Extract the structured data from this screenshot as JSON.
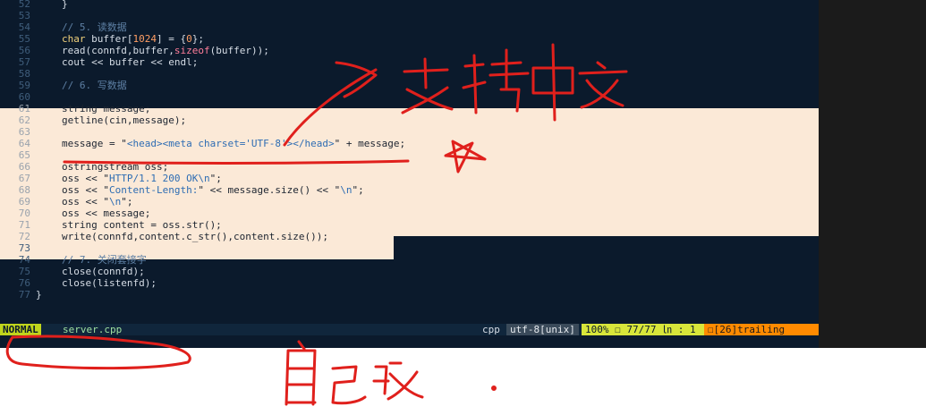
{
  "editor": {
    "lines": [
      {
        "num": "52",
        "parts": [
          {
            "t": "}",
            "c": ""
          }
        ],
        "indent": true
      },
      {
        "num": "53",
        "parts": []
      },
      {
        "num": "54",
        "parts": [
          {
            "t": "// 5. 读数据",
            "c": "comment"
          }
        ],
        "indent": true
      },
      {
        "num": "55",
        "parts": [
          {
            "t": "char",
            "c": "type"
          },
          {
            "t": " buffer[",
            "c": ""
          },
          {
            "t": "1024",
            "c": "num"
          },
          {
            "t": "] = {",
            "c": ""
          },
          {
            "t": "0",
            "c": "num"
          },
          {
            "t": "};",
            "c": ""
          }
        ],
        "indent": true
      },
      {
        "num": "56",
        "parts": [
          {
            "t": "read(connfd,buffer,",
            "c": ""
          },
          {
            "t": "sizeof",
            "c": "kw"
          },
          {
            "t": "(buffer));",
            "c": ""
          }
        ],
        "indent": true
      },
      {
        "num": "57",
        "parts": [
          {
            "t": "cout << buffer << endl;",
            "c": ""
          }
        ],
        "indent": true
      },
      {
        "num": "58",
        "parts": []
      },
      {
        "num": "59",
        "parts": [
          {
            "t": "// 6. 写数据",
            "c": "comment"
          }
        ],
        "indent": true
      },
      {
        "num": "60",
        "parts": []
      },
      {
        "num": "61",
        "parts": [
          {
            "t": "string message;",
            "c": ""
          }
        ],
        "indent": true,
        "sel": true
      },
      {
        "num": "62",
        "parts": [
          {
            "t": "getline(cin,message);",
            "c": ""
          }
        ],
        "indent": true,
        "sel": true
      },
      {
        "num": "63",
        "parts": [],
        "sel": true
      },
      {
        "num": "64",
        "parts": [
          {
            "t": "message = \"",
            "c": ""
          },
          {
            "t": "<head><meta charset='UTF-8'></head>",
            "c": "str"
          },
          {
            "t": "\" + message;",
            "c": ""
          }
        ],
        "indent": true,
        "sel": true
      },
      {
        "num": "65",
        "parts": [],
        "sel": true
      },
      {
        "num": "66",
        "parts": [
          {
            "t": "ostringstream oss;",
            "c": ""
          }
        ],
        "indent": true,
        "sel": true
      },
      {
        "num": "67",
        "parts": [
          {
            "t": "oss << \"",
            "c": ""
          },
          {
            "t": "HTTP/1.1 200 OK\\n",
            "c": "str"
          },
          {
            "t": "\";",
            "c": ""
          }
        ],
        "indent": true,
        "sel": true
      },
      {
        "num": "68",
        "parts": [
          {
            "t": "oss << \"",
            "c": ""
          },
          {
            "t": "Content-Length:",
            "c": "str"
          },
          {
            "t": "\" << message.size() << \"",
            "c": ""
          },
          {
            "t": "\\n",
            "c": "str"
          },
          {
            "t": "\";",
            "c": ""
          }
        ],
        "indent": true,
        "sel": true
      },
      {
        "num": "69",
        "parts": [
          {
            "t": "oss << \"",
            "c": ""
          },
          {
            "t": "\\n",
            "c": "str"
          },
          {
            "t": "\";",
            "c": ""
          }
        ],
        "indent": true,
        "sel": true
      },
      {
        "num": "70",
        "parts": [
          {
            "t": "oss << message;",
            "c": ""
          }
        ],
        "indent": true,
        "sel": true
      },
      {
        "num": "71",
        "parts": [
          {
            "t": "string content = oss.str();",
            "c": ""
          }
        ],
        "indent": true,
        "sel": true
      },
      {
        "num": "72",
        "parts": [
          {
            "t": "write(connfd,content.c_str(),content.size());",
            "c": ""
          }
        ],
        "indent": true,
        "sel": true
      },
      {
        "num": "73",
        "parts": []
      },
      {
        "num": "74",
        "parts": [
          {
            "t": "// 7. 关闭套接字",
            "c": "comment"
          }
        ],
        "indent": true
      },
      {
        "num": "75",
        "parts": [
          {
            "t": "close(connfd);",
            "c": ""
          }
        ],
        "indent": true
      },
      {
        "num": "76",
        "parts": [
          {
            "t": "close(listenfd);",
            "c": ""
          }
        ],
        "indent": true
      },
      {
        "num": "77",
        "parts": [
          {
            "t": "}",
            "c": ""
          }
        ]
      }
    ]
  },
  "statusline": {
    "mode": "NORMAL",
    "filename": "server.cpp",
    "filetype": "cpp",
    "encoding": "utf-8[unix]",
    "position": "100% ☐  77/77 ㏑ :  1",
    "trailing": "☐[26]trailing"
  },
  "annotations": {
    "top_text": "支持中文",
    "bottom_text": "自己改",
    "stroke_color": "#e0201c"
  }
}
